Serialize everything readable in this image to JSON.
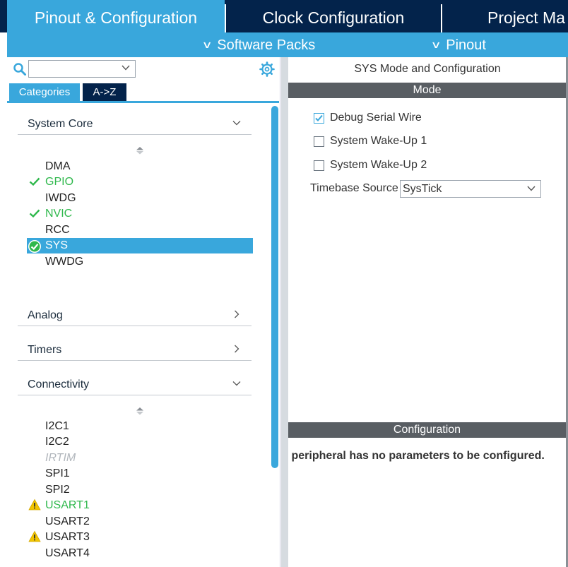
{
  "top_tabs": [
    {
      "label": "Pinout & Configuration",
      "active": true
    },
    {
      "label": "Clock Configuration",
      "active": false
    },
    {
      "label": "Project Ma",
      "active": false
    }
  ],
  "submenu": [
    {
      "label": "Software Packs",
      "icon": "chevron-down-icon"
    },
    {
      "label": "Pinout",
      "icon": "chevron-down-icon"
    }
  ],
  "left": {
    "search": {
      "value": "",
      "icon": "search-icon"
    },
    "settings_icon": "gear-icon",
    "view_tabs": [
      {
        "label": "Categories",
        "active": true
      },
      {
        "label": "A->Z",
        "active": false
      }
    ],
    "categories": [
      {
        "label": "System Core",
        "expanded": true,
        "items": [
          {
            "label": "DMA",
            "status": "none"
          },
          {
            "label": "GPIO",
            "status": "ok"
          },
          {
            "label": "IWDG",
            "status": "none"
          },
          {
            "label": "NVIC",
            "status": "ok"
          },
          {
            "label": "RCC",
            "status": "none"
          },
          {
            "label": "SYS",
            "status": "selected-ok"
          },
          {
            "label": "WWDG",
            "status": "none"
          }
        ]
      },
      {
        "label": "Analog",
        "expanded": false
      },
      {
        "label": "Timers",
        "expanded": false
      },
      {
        "label": "Connectivity",
        "expanded": true,
        "items": [
          {
            "label": "I2C1",
            "status": "none"
          },
          {
            "label": "I2C2",
            "status": "none"
          },
          {
            "label": "IRTIM",
            "status": "disabled"
          },
          {
            "label": "SPI1",
            "status": "none"
          },
          {
            "label": "SPI2",
            "status": "none"
          },
          {
            "label": "USART1",
            "status": "warning"
          },
          {
            "label": "USART2",
            "status": "none"
          },
          {
            "label": "USART3",
            "status": "warning"
          },
          {
            "label": "USART4",
            "status": "none"
          }
        ]
      }
    ]
  },
  "right": {
    "title": "SYS Mode and Configuration",
    "mode_header": "Mode",
    "options": [
      {
        "label": "Debug Serial Wire",
        "checked": true
      },
      {
        "label": "System Wake-Up 1",
        "checked": false
      },
      {
        "label": "System Wake-Up 2",
        "checked": false
      }
    ],
    "timebase": {
      "label": "Timebase Source",
      "value": "SysTick"
    },
    "config_header": "Configuration",
    "warning": "Warning: This peripheral has no parameters to be configured."
  },
  "colors": {
    "accent": "#39a7dc",
    "navy": "#03234b",
    "ok_green": "#2fb84c",
    "warning_yellow": "#f2c500"
  }
}
